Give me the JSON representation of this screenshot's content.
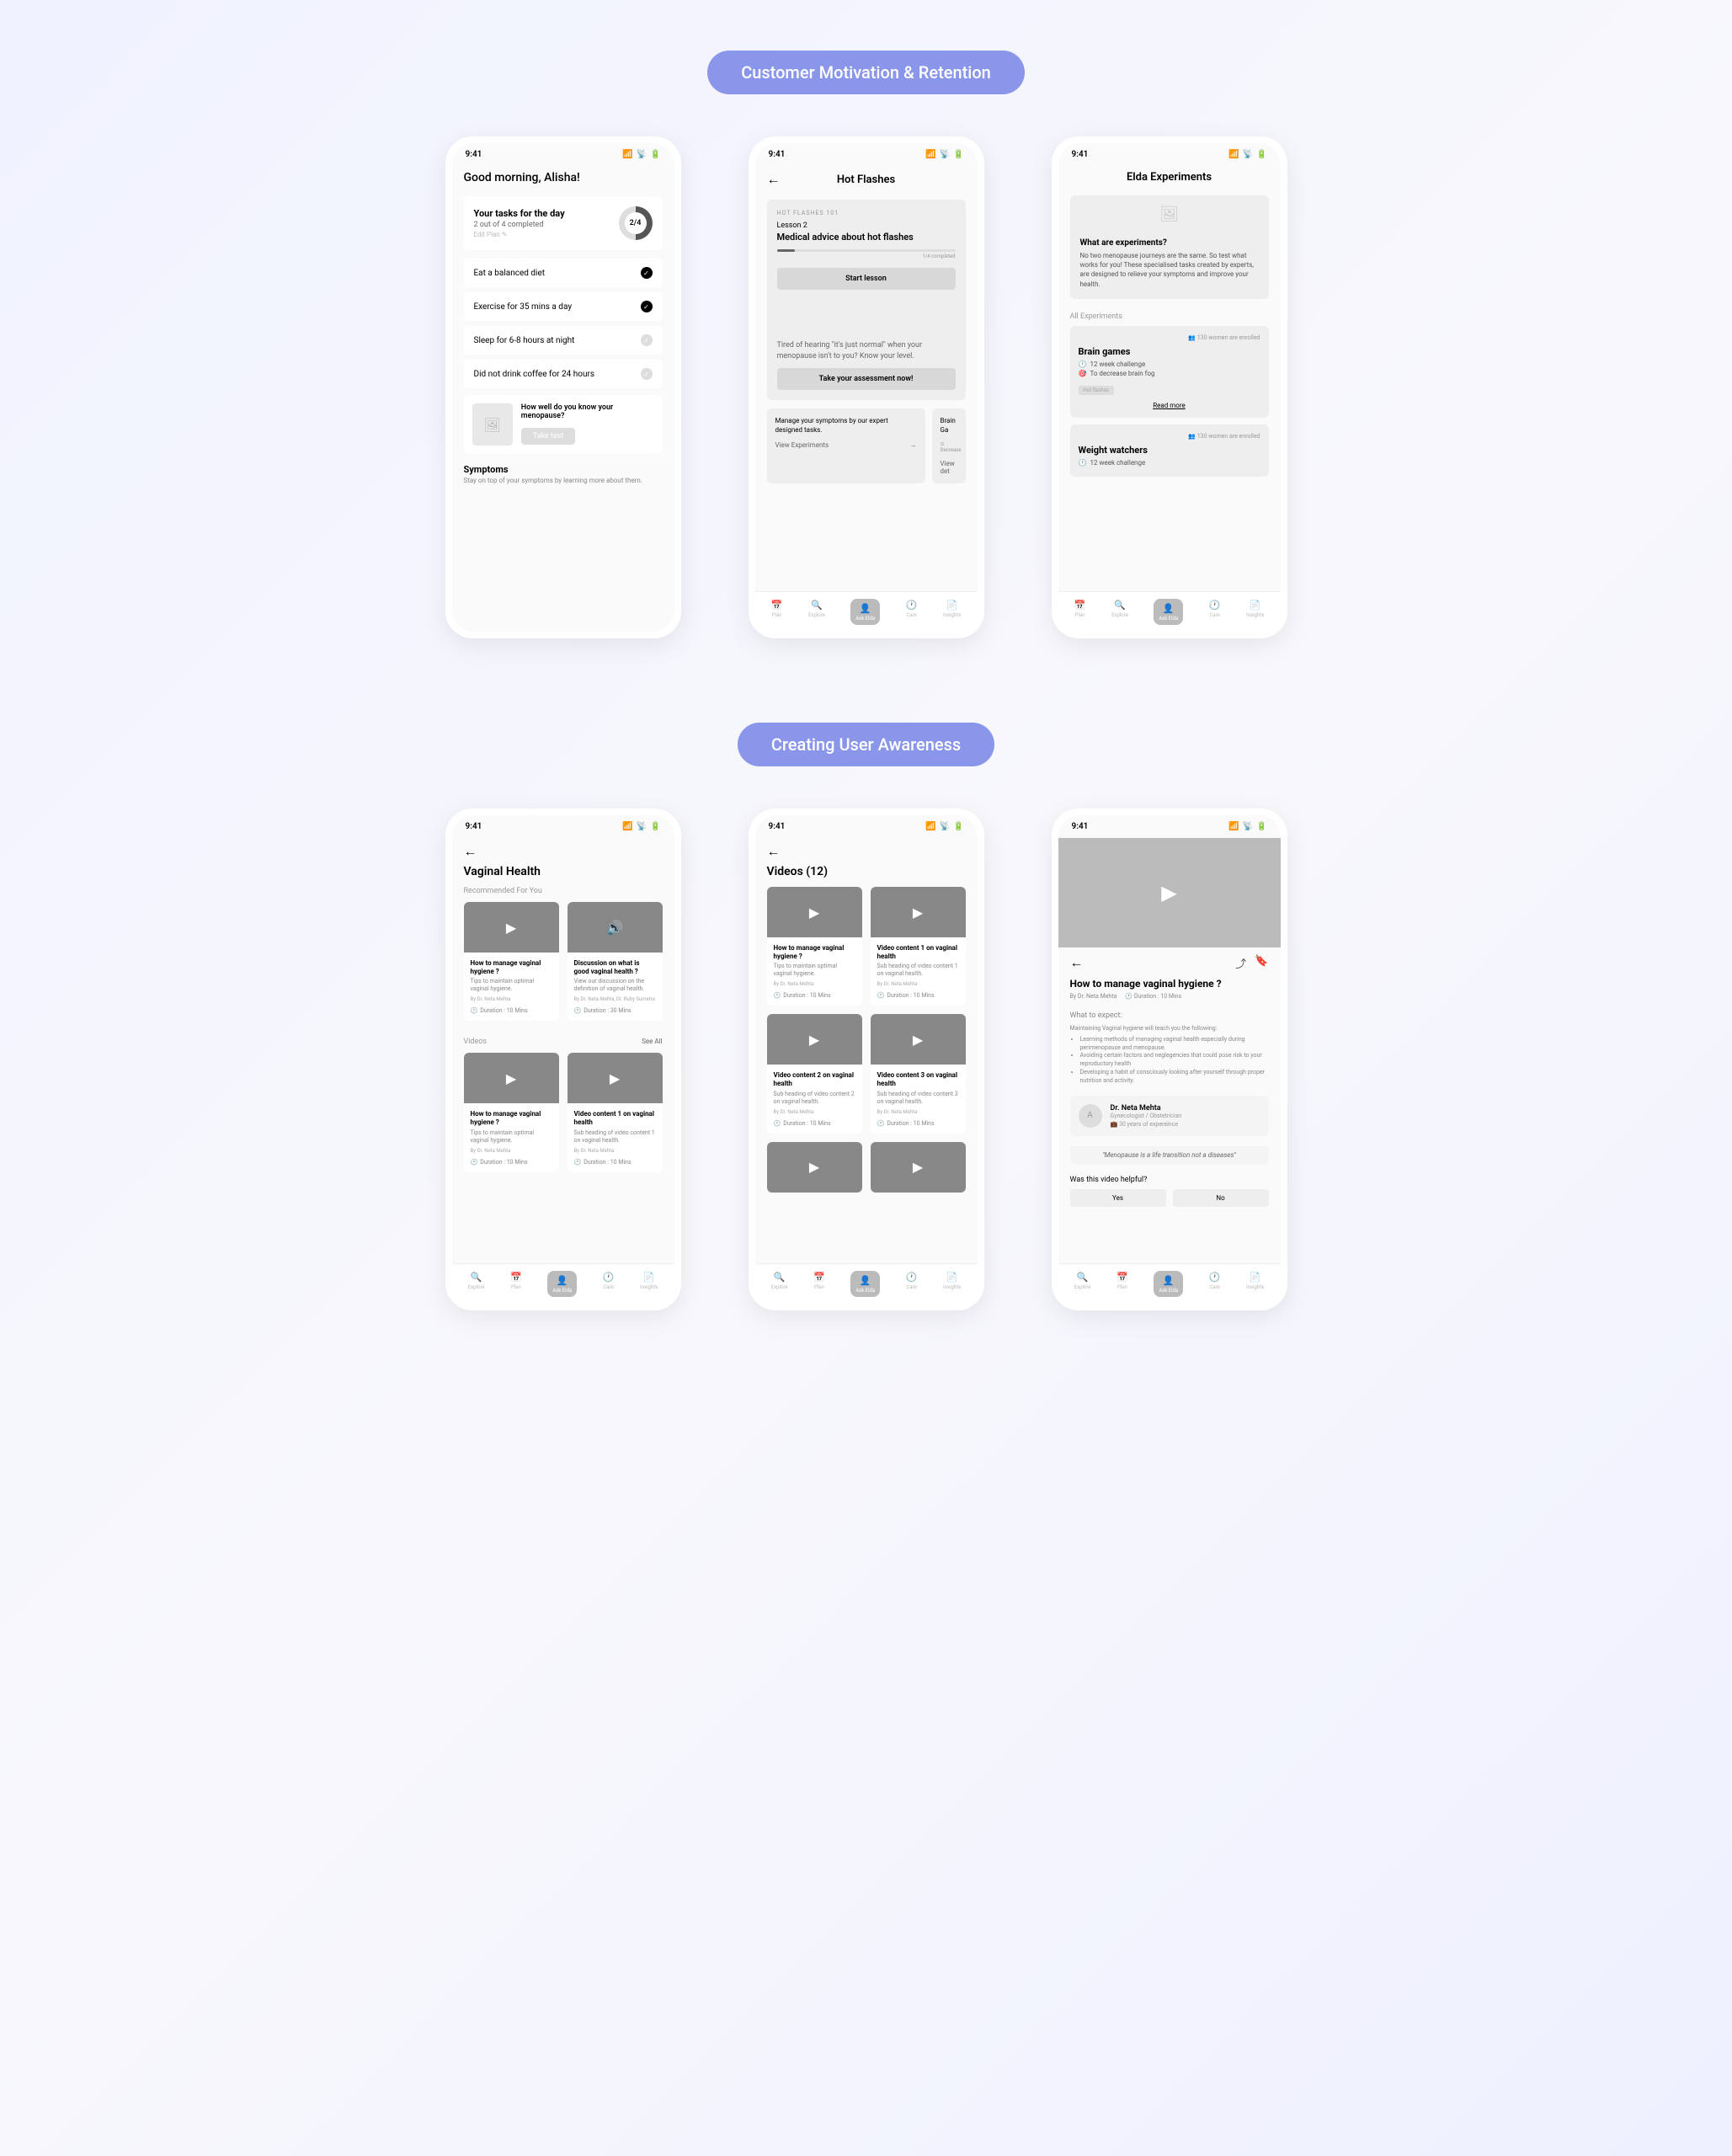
{
  "sectionTitles": [
    "Customer Motivation & Retention",
    "Creating User Awareness"
  ],
  "statusTime": "9:41",
  "s1": {
    "greeting": "Good morning, Alisha!",
    "tasksHeading": "Your tasks for the day",
    "tasksSub": "2 out of 4 completed",
    "editPlan": "Edit Plan ✎",
    "progressText": "2/4",
    "tasks": [
      {
        "label": "Eat a balanced diet",
        "done": true
      },
      {
        "label": "Exercise for 35 mins a day",
        "done": true
      },
      {
        "label": "Sleep for 6-8 hours at night",
        "done": false
      },
      {
        "label": "Did not drink coffee for 24 hours",
        "done": false
      }
    ],
    "promoText": "How well do you know your menopause?",
    "promoBtn": "Take test",
    "symptomsLabel": "Symptoms",
    "symptomsDesc": "Stay on top of your symptoms by learning more about them."
  },
  "s2": {
    "title": "Hot Flashes",
    "badge": "HOT FLASHES 101",
    "lessonNum": "Lesson 2",
    "lessonTitle": "Medical advice about hot flashes",
    "progressText": "1/4 completed",
    "startBtn": "Start lesson",
    "assessmentText": "Tired of hearing \"it's just normal\" when your menopause isn't to you? Know your level.",
    "assessmentBtn": "Take your assessment now!",
    "expCard1": "Manage your symptoms by our expert designed tasks.",
    "expCard1Link": "View Experiments",
    "expCard2": "Brain Ga",
    "expCard2Sub": "⊙ Decrease",
    "expCard2Link": "View det"
  },
  "s3": {
    "title": "Elda Experiments",
    "infoQ": "What are experiments?",
    "infoText": "No two menopause journeys are the same. So test what works for you! These specialised tasks created by experts, are designed to relieve your symptoms and improve your health.",
    "allExpLabel": "All Experiments",
    "enroll": "👥 130 women are enrolled",
    "exp1": {
      "name": "Brain games",
      "detail1": "12 week challenge",
      "detail2": "To decrease brain fog",
      "tag": "Hot flashes",
      "readMore": "Read more"
    },
    "exp2": {
      "name": "Weight watchers",
      "detail1": "12 week challenge"
    }
  },
  "s4": {
    "title": "Vaginal Health",
    "recommended": "Recommended For You",
    "v1": {
      "title": "How to manage vaginal hygiene ?",
      "desc": "Tips to maintain optimal vaginal hygiene.",
      "author": "By Dr. Neta Mehta",
      "duration": "Duration : 10 Mins"
    },
    "v2": {
      "title": "Discussion on what is good vaginal health ?",
      "desc": "View our discussion on the definition of vaginal health.",
      "author": "By Dr. Neta Mehta, Dr. Ruby Sumetra",
      "duration": "Duration : 30 Mins"
    },
    "videosLabel": "Videos",
    "seeAll": "See All",
    "v3": {
      "title": "How to manage vaginal hygiene ?",
      "desc": "Tips to maintain optimal vaginal hygiene.",
      "author": "By Dr. Neta Mehta",
      "duration": "Duration : 10 Mins"
    },
    "v4": {
      "title": "Video content 1 on vaginal health",
      "desc": "Sub heading of video content 1 on vaginal health.",
      "author": "By Dr. Neta Mehta",
      "duration": "Duration : 10 Mins"
    }
  },
  "s5": {
    "title": "Videos (12)",
    "v1": {
      "title": "How to manage vaginal hygiene ?",
      "desc": "Tips to maintain optimal vaginal hygiene.",
      "author": "By Dr. Neta Mehta",
      "duration": "Duration : 10 Mins"
    },
    "v2": {
      "title": "Video content 1 on vaginal health",
      "desc": "Sub heading of video content 1 on vaginal health.",
      "author": "By Dr. Neta Mehta",
      "duration": "Duration : 10 Mins"
    },
    "v3": {
      "title": "Video content 2 on vaginal health",
      "desc": "Sub heading of video content 2 on vaginal health.",
      "author": "By Dr. Neta Mehta",
      "duration": "Duration : 10 Mins"
    },
    "v4": {
      "title": "Video content 3 on vaginal health",
      "desc": "Sub heading of video content 3 on vaginal health.",
      "author": "By Dr. Neta Mehta",
      "duration": "Duration : 10 Mins"
    }
  },
  "s6": {
    "title": "How to manage vaginal hygiene ?",
    "author": "By Dr. Neta Mehta",
    "duration": "Duration : 10 Mins",
    "expectLabel": "What to expect:",
    "expectIntro": "Maintaining Vaginal hygiene will teach you the following:",
    "expectItems": [
      "Learning methods of managing vaginal health especially during perimenopause and menopause.",
      "Avoiding certain factors and neglegencies that could pose risk to your reproductory health",
      "Developing a habit of consciously looking after yourself through proper nutrition and activity."
    ],
    "doctor": {
      "name": "Dr. Neta Mehta",
      "role": "Gynecologist / Obstetrician",
      "exp": "30 years of expereince"
    },
    "quote": "\"Menopause is a life transition not a diseases\"",
    "helpfulLabel": "Was this video helpful?",
    "yes": "Yes",
    "no": "No"
  },
  "nav": {
    "plan": "Plan",
    "explore": "Explore",
    "ask": "Ask Elda",
    "care": "Care",
    "insights": "Insights"
  }
}
